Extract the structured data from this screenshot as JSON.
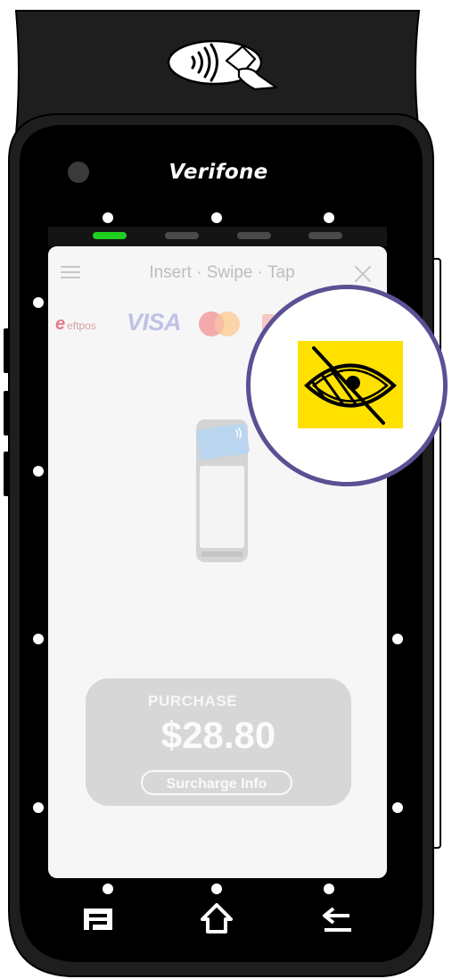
{
  "device": {
    "brand": "Verifone"
  },
  "screen": {
    "title": "Insert · Swipe · Tap",
    "card_logos": {
      "eftpos": "eftpos",
      "visa": "VISA"
    },
    "purchase": {
      "label": "PURCHASE",
      "amount": "$28.80",
      "surcharge_button": "Surcharge Info"
    }
  },
  "status_leds": [
    {
      "state": "on",
      "color": "#20d020"
    },
    {
      "state": "off",
      "color": "#4a4a4a"
    },
    {
      "state": "off",
      "color": "#4a4a4a"
    },
    {
      "state": "off",
      "color": "#4a4a4a"
    }
  ],
  "icons": {
    "contactless": "contactless-tap-icon",
    "menu": "hamburger-menu-icon",
    "close": "close-icon",
    "hidden": "eye-slash-icon",
    "nav_menu": "menu-key-icon",
    "nav_home": "home-icon",
    "nav_back": "back-icon"
  },
  "colors": {
    "accent_ring": "#5b5094",
    "hidden_badge": "#ffe100"
  }
}
